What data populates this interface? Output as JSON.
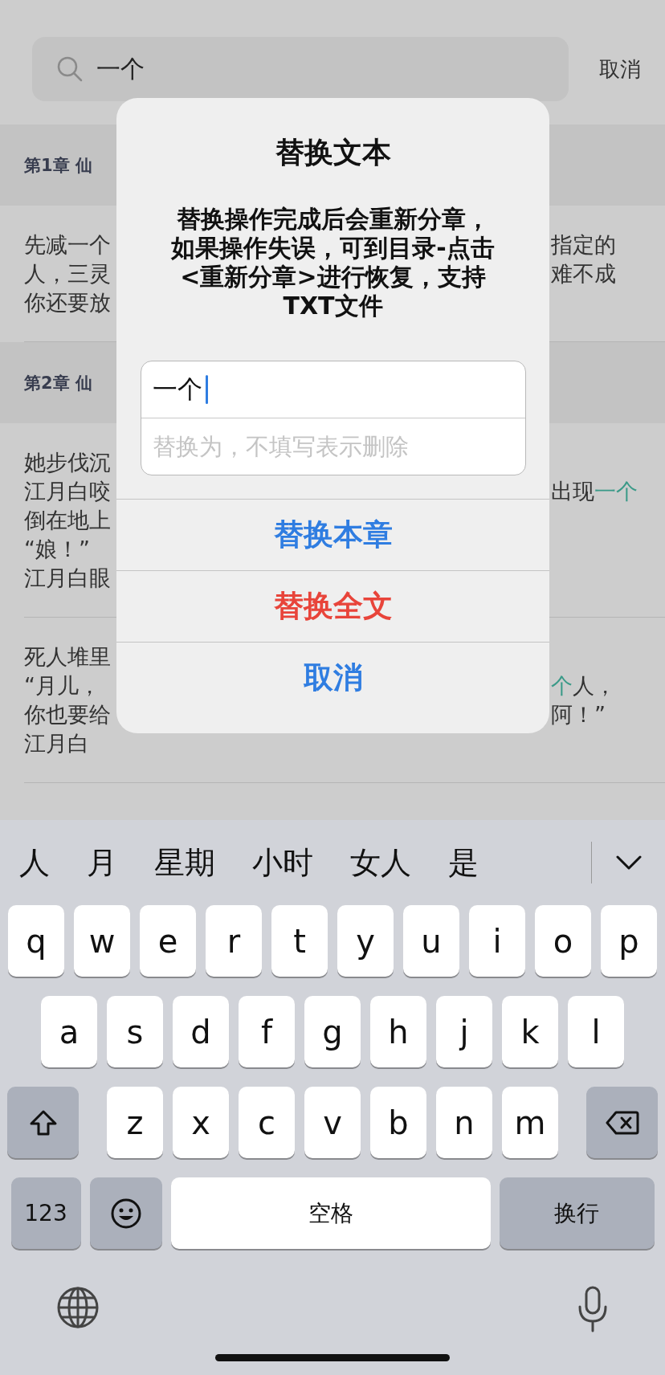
{
  "search": {
    "value": "一个",
    "cancel": "取消"
  },
  "results": [
    {
      "kind": "chapter",
      "title": "第1章 仙"
    },
    {
      "kind": "excerpt",
      "lines": [
        {
          "left": "先减一个",
          "right": [
            {
              "text": "指定的",
              "highlight": false
            }
          ]
        },
        {
          "left": "人，三灵",
          "right": [
            {
              "text": "难不成",
              "highlight": false
            }
          ]
        },
        {
          "left": "你还要放"
        }
      ]
    },
    {
      "kind": "chapter",
      "title": "第2章 仙"
    },
    {
      "kind": "excerpt",
      "lines": [
        {
          "left": "她步伐沉"
        },
        {
          "left": "江月白咬",
          "right": [
            {
              "text": "出现",
              "highlight": false
            },
            {
              "text": "一个",
              "highlight": true
            }
          ]
        },
        {
          "left": "倒在地上"
        },
        {
          "left": "“娘！”"
        },
        {
          "left": "江月白眼"
        }
      ]
    },
    {
      "kind": "excerpt",
      "lines": [
        {
          "left": "死人堆里"
        },
        {
          "left": "“月儿，",
          "right": [
            {
              "text": "个",
              "highlight": true
            },
            {
              "text": "人，",
              "highlight": false
            }
          ]
        },
        {
          "left": "你也要给",
          "right": [
            {
              "text": "阿！”",
              "highlight": false
            }
          ]
        },
        {
          "left": "江月白"
        }
      ]
    }
  ],
  "dialog": {
    "title": "替换文本",
    "message": "替换操作完成后会重新分章，如果操作失误，可到目录-点击<重新分章>进行恢复，支持TXT文件",
    "find_value": "一个",
    "replace_placeholder": "替换为，不填写表示删除",
    "buttons": [
      {
        "label": "替换本章",
        "kind": "default"
      },
      {
        "label": "替换全文",
        "kind": "destructive"
      },
      {
        "label": "取消",
        "kind": "cancel"
      }
    ]
  },
  "keyboard": {
    "candidates": [
      "人",
      "月",
      "星期",
      "小时",
      "女人",
      "是"
    ],
    "rows": [
      {
        "keys": [
          {
            "kind": "letter",
            "label": "q"
          },
          {
            "kind": "letter",
            "label": "w"
          },
          {
            "kind": "letter",
            "label": "e"
          },
          {
            "kind": "letter",
            "label": "r"
          },
          {
            "kind": "letter",
            "label": "t"
          },
          {
            "kind": "letter",
            "label": "y"
          },
          {
            "kind": "letter",
            "label": "u"
          },
          {
            "kind": "letter",
            "label": "i"
          },
          {
            "kind": "letter",
            "label": "o"
          },
          {
            "kind": "letter",
            "label": "p"
          }
        ]
      },
      {
        "keys": [
          {
            "kind": "letter",
            "label": "a"
          },
          {
            "kind": "letter",
            "label": "s"
          },
          {
            "kind": "letter",
            "label": "d"
          },
          {
            "kind": "letter",
            "label": "f"
          },
          {
            "kind": "letter",
            "label": "g"
          },
          {
            "kind": "letter",
            "label": "h"
          },
          {
            "kind": "letter",
            "label": "j"
          },
          {
            "kind": "letter",
            "label": "k"
          },
          {
            "kind": "letter",
            "label": "l"
          }
        ]
      },
      {
        "keys": [
          {
            "kind": "shift"
          },
          {
            "kind": "letter",
            "label": "z"
          },
          {
            "kind": "letter",
            "label": "x"
          },
          {
            "kind": "letter",
            "label": "c"
          },
          {
            "kind": "letter",
            "label": "v"
          },
          {
            "kind": "letter",
            "label": "b"
          },
          {
            "kind": "letter",
            "label": "n"
          },
          {
            "kind": "letter",
            "label": "m"
          },
          {
            "kind": "delete"
          }
        ]
      },
      {
        "keys": [
          {
            "kind": "numbers",
            "label": "123"
          },
          {
            "kind": "emoji"
          },
          {
            "kind": "space",
            "label": "空格"
          },
          {
            "kind": "return",
            "label": "换行"
          }
        ]
      }
    ]
  }
}
